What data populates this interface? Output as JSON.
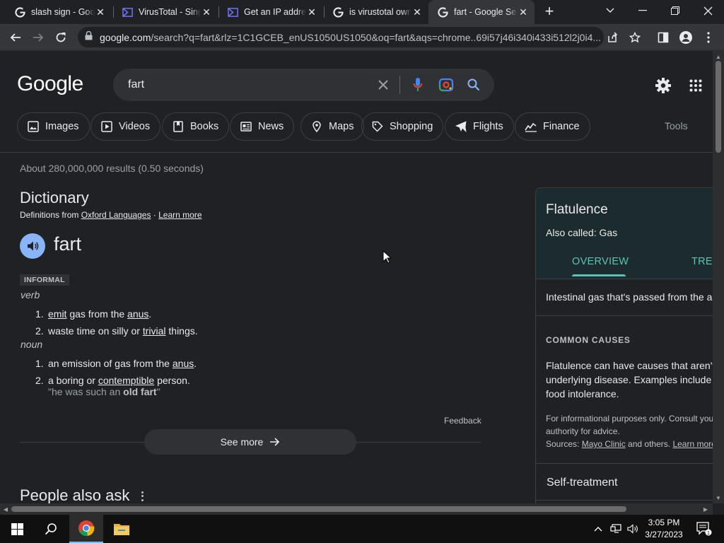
{
  "browser": {
    "tabs": [
      {
        "title": "slash sign - Goo",
        "favicon": "google-g-icon",
        "active": false
      },
      {
        "title": "VirusTotal - Sing",
        "favicon": "virustotal-icon",
        "active": false
      },
      {
        "title": "Get an IP addre",
        "favicon": "virustotal-icon",
        "active": false
      },
      {
        "title": "is virustotal own",
        "favicon": "google-g-icon",
        "active": false
      },
      {
        "title": "fart - Google Se",
        "favicon": "google-g-icon",
        "active": true
      }
    ],
    "url_host": "google.com",
    "url_rest": "/search?q=fart&rlz=1C1GCEB_enUS1050US1050&oq=fart&aqs=chrome..69i57j46i340i433i512l2j0i4..."
  },
  "google": {
    "logo": "Google",
    "query": "fart",
    "chips": [
      "Images",
      "Videos",
      "Books",
      "News",
      "Maps",
      "Shopping",
      "Flights",
      "Finance"
    ],
    "tools": "Tools",
    "stats": "About 280,000,000 results (0.50 seconds)"
  },
  "dictionary": {
    "title": "Dictionary",
    "source_prefix": "Definitions from ",
    "source_link": "Oxford Languages",
    "source_sep": " · ",
    "learn_more": "Learn more",
    "headword": "fart",
    "register": "INFORMAL",
    "pos_verb": "verb",
    "verb_defs": [
      {
        "num": "1.",
        "a": "emit",
        "b": " gas from the ",
        "c": "anus",
        "d": "."
      },
      {
        "num": "2.",
        "a": "waste time on silly or ",
        "b": "trivial",
        "c": " things."
      }
    ],
    "pos_noun": "noun",
    "noun_defs": [
      {
        "num": "1.",
        "a": "an emission of gas from the ",
        "b": "anus",
        "c": "."
      },
      {
        "num": "2.",
        "a": "a boring or ",
        "b": "contemptible",
        "c": " person."
      }
    ],
    "example_pre": "\"he was such an ",
    "example_bold": "old fart",
    "example_post": "\"",
    "feedback": "Feedback",
    "see_more": "See more",
    "people_also_ask": "People also ask"
  },
  "panel": {
    "title": "Flatulence",
    "also_called": "Also called: Gas",
    "tab_overview": "OVERVIEW",
    "tab_treatment": "TRE",
    "summary": "Intestinal gas that's passed from the a",
    "causes_heading": "COMMON CAUSES",
    "causes_line1": "Flatulence can have causes that aren't",
    "causes_line2": "underlying disease. Examples include",
    "causes_line3": "food intolerance.",
    "disclaimer1": "For informational purposes only. Consult you",
    "disclaimer2": "authority for advice.",
    "sources_prefix": "Sources: ",
    "sources_link": "Mayo Clinic",
    "sources_mid": " and others. ",
    "sources_learn": "Learn more",
    "self_treatment": "Self-treatment"
  },
  "taskbar": {
    "time": "3:05 PM",
    "date": "3/27/2023",
    "notification_count": "1"
  },
  "colors": {
    "accent_teal": "#5ec2b7",
    "link_blue": "#8ab4f8"
  }
}
